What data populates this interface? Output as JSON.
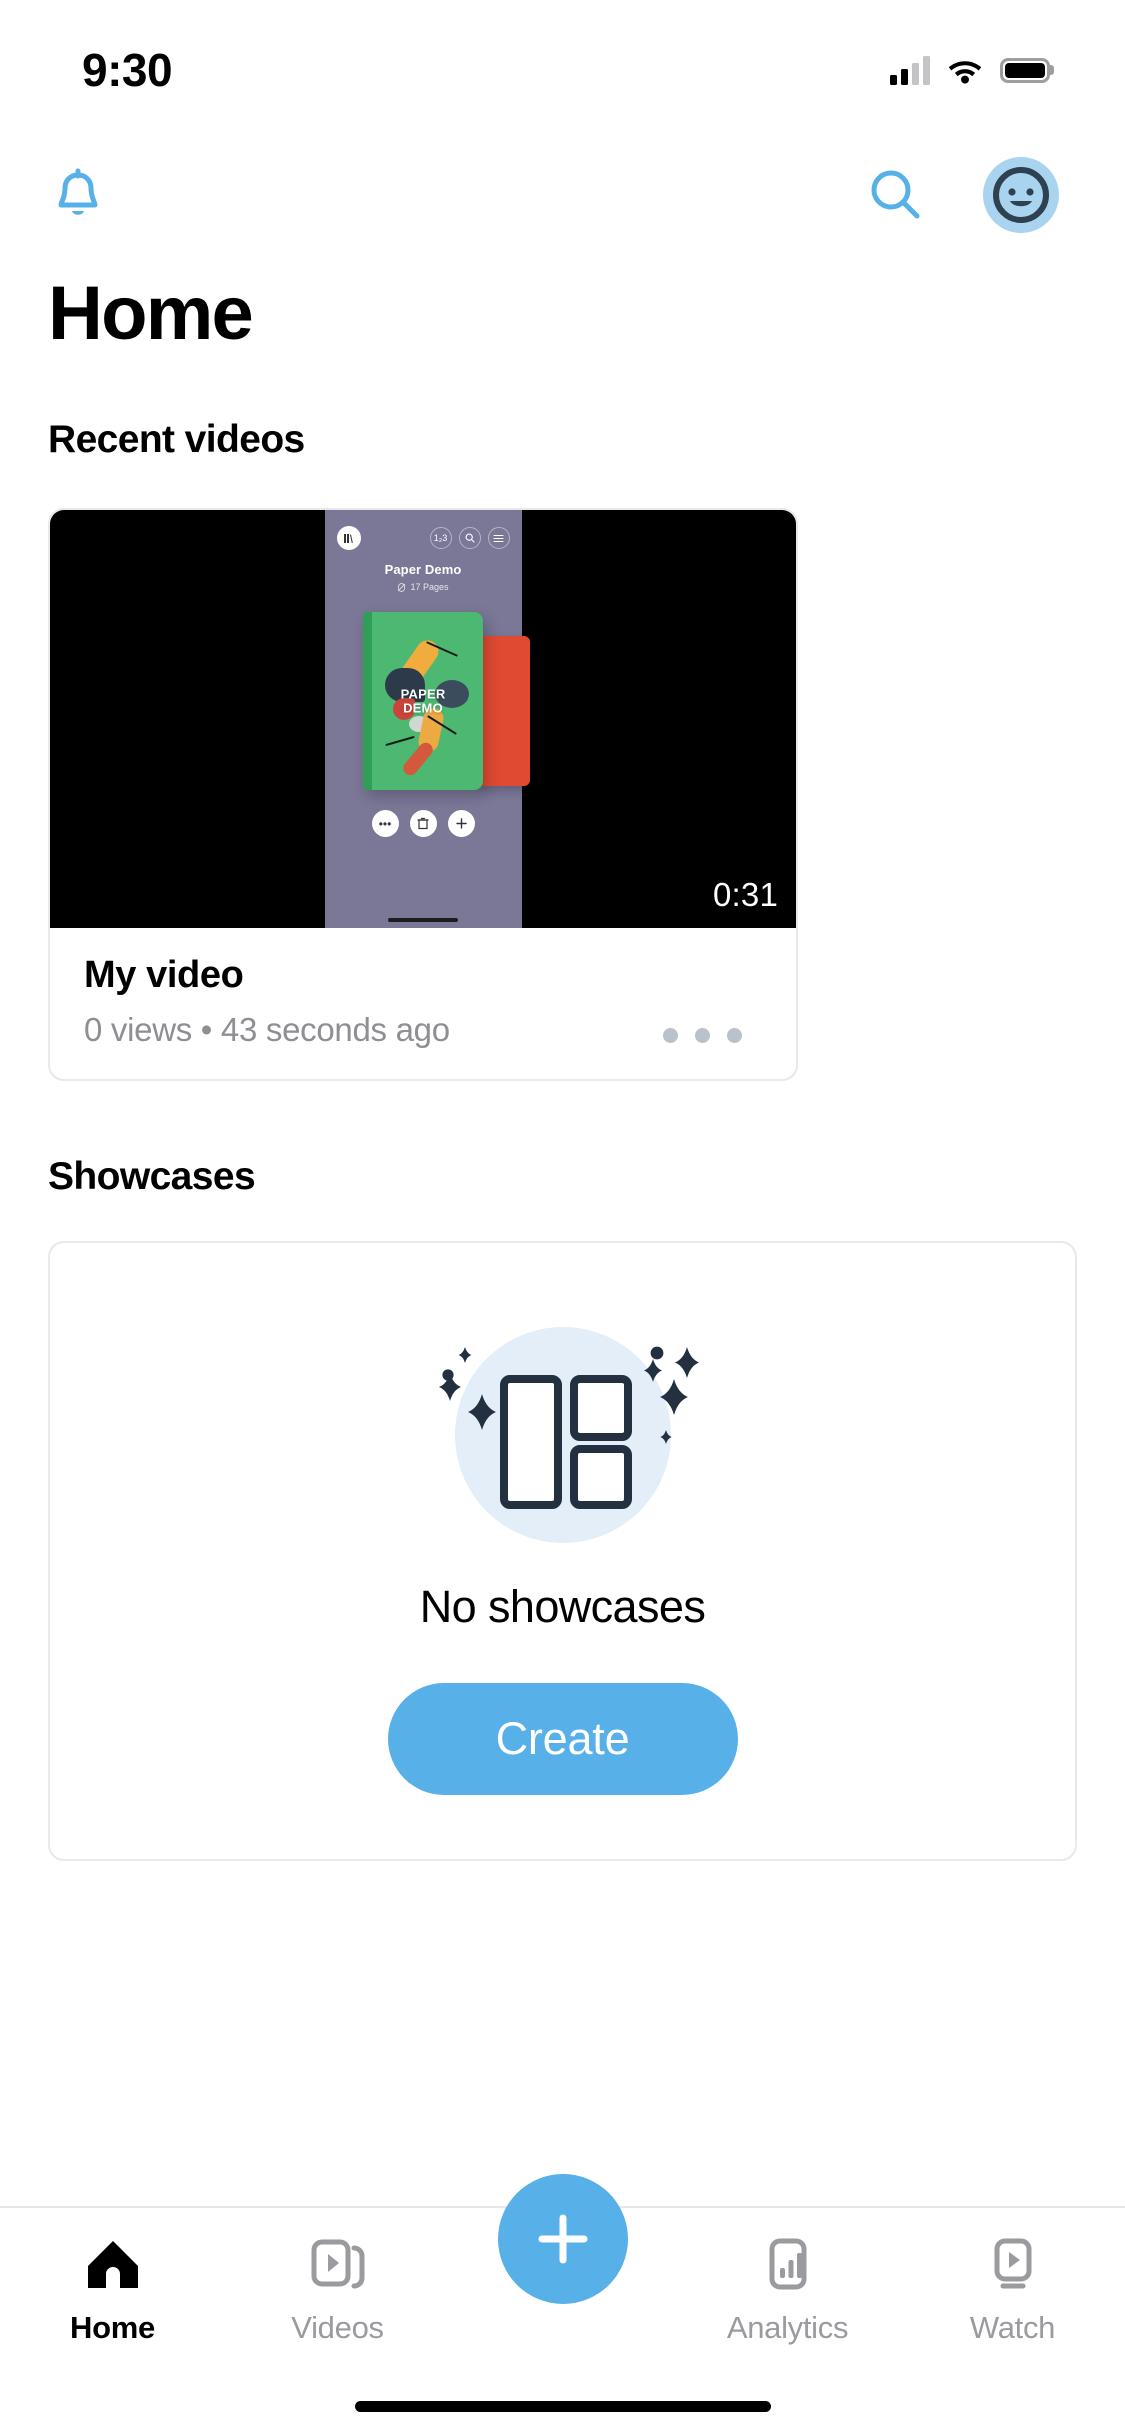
{
  "status_bar": {
    "time": "9:30",
    "signal_icon": "cellular-signal-icon",
    "wifi_icon": "wifi-icon",
    "battery_icon": "battery-icon"
  },
  "top_bar": {
    "bell_icon": "notifications-bell-icon",
    "search_icon": "search-icon",
    "avatar_icon": "user-avatar-icon"
  },
  "page": {
    "title": "Home"
  },
  "recent_videos": {
    "heading": "Recent videos",
    "items": [
      {
        "title": "My video",
        "meta": "0 views • 43 seconds ago",
        "duration": "0:31",
        "menu_icon": "more-options-icon",
        "thumbnail": {
          "doc_title": "Paper Demo",
          "doc_pages": "17 Pages",
          "book_label_line1": "PAPER",
          "book_label_line2": "DEMO",
          "logo_icon": "books-logo-icon",
          "action_icons": [
            "page-count-icon",
            "search-icon",
            "menu-icon"
          ],
          "control_icons": [
            "more-icon",
            "delete-icon",
            "add-icon"
          ]
        }
      }
    ]
  },
  "showcases": {
    "heading": "Showcases",
    "empty_state": {
      "illustration_icon": "showcase-grid-illustration",
      "message": "No showcases",
      "button_label": "Create"
    }
  },
  "bottom_nav": {
    "items": [
      {
        "label": "Home",
        "icon": "home-icon",
        "active": true
      },
      {
        "label": "Videos",
        "icon": "videos-icon",
        "active": false
      },
      {
        "label": "Analytics",
        "icon": "analytics-icon",
        "active": false
      },
      {
        "label": "Watch",
        "icon": "watch-icon",
        "active": false
      }
    ],
    "fab": {
      "icon": "plus-icon",
      "label": ""
    }
  },
  "colors": {
    "accent": "#57b0e8",
    "avatar_bg": "#a8d4ef",
    "illustration_bg": "#e3eef9",
    "illustration_stroke": "#22303f",
    "muted_text": "#8e8e93",
    "nav_inactive": "#9a9a9f",
    "card_border": "#e9e9e9",
    "thumb_bg": "#7a7797"
  }
}
